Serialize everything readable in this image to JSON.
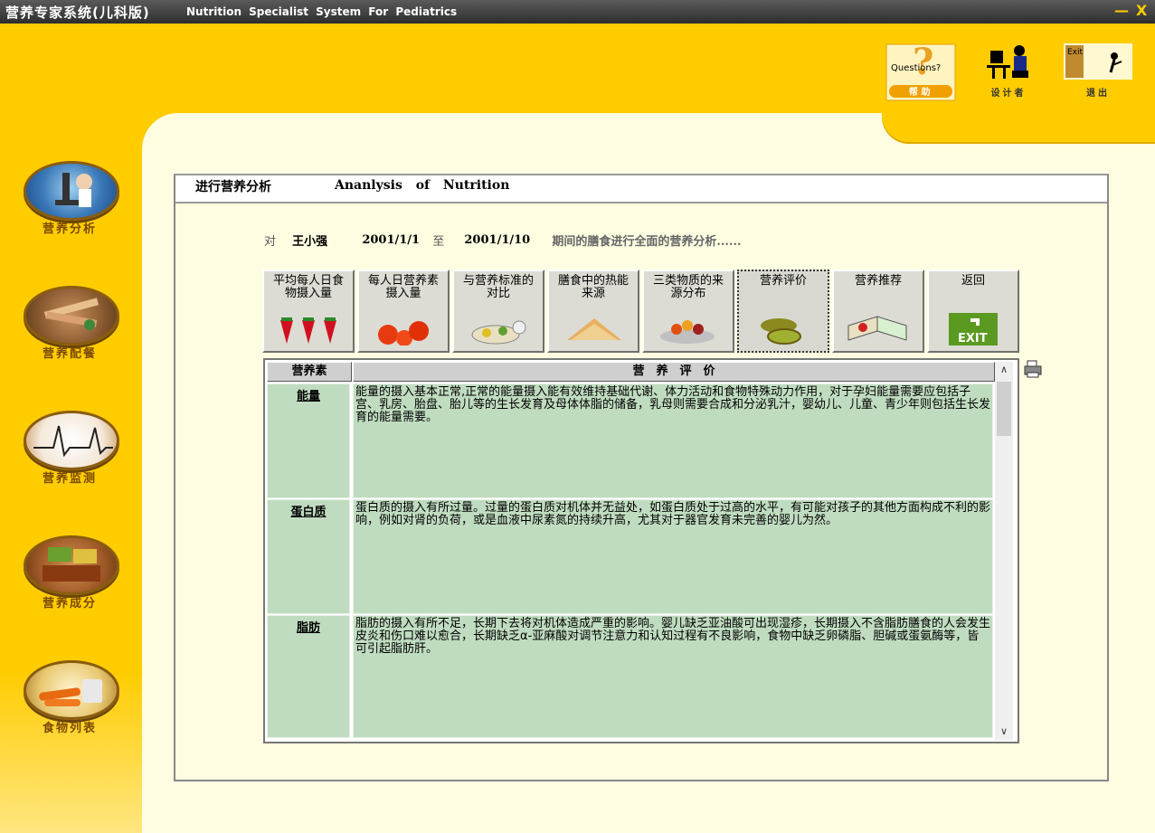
{
  "titlebar": {
    "app_name": "营养专家系统(儿科版)",
    "subtitle": "Nutrition Specialist System For Pediatrics",
    "minimize": "—",
    "close": "X"
  },
  "sidebar": {
    "items": [
      {
        "label": "营养分析",
        "icon": "microscope-icon"
      },
      {
        "label": "营养配餐",
        "icon": "meal-plate-icon"
      },
      {
        "label": "营养监测",
        "icon": "heartbeat-icon"
      },
      {
        "label": "营养成分",
        "icon": "food-box-icon"
      },
      {
        "label": "食物列表",
        "icon": "carrots-icon"
      }
    ]
  },
  "toolbar": {
    "help_image_text": "Questions?",
    "help_label": "帮 助",
    "designer_label": "设计者",
    "exit_image_text": "Exit",
    "exit_label": "退出"
  },
  "panel": {
    "title_cn": "进行营养分析",
    "title_en": "Ananlysis of Nutrition",
    "prefix": "对",
    "person": "王小强",
    "date_from": "2001/1/1",
    "to_word": "至",
    "date_to": "2001/1/10",
    "suffix": "期间的膳食进行全面的营养分析......"
  },
  "function_buttons": [
    {
      "label": "平均每人日食物摄入量",
      "icon": "strawberry-icon"
    },
    {
      "label": "每人日营养素摄入量",
      "icon": "tomato-icon"
    },
    {
      "label": "与营养标准的对比",
      "icon": "food-plate-icon"
    },
    {
      "label": "膳食中的热能来源",
      "icon": "bread-icon"
    },
    {
      "label": "三类物质的来源分布",
      "icon": "fruit-basket-icon"
    },
    {
      "label": "营养评价",
      "icon": "kiwi-icon",
      "selected": true
    },
    {
      "label": "营养推荐",
      "icon": "book-icon"
    },
    {
      "label": "返回",
      "icon": "exit-sign-icon",
      "image_text": "EXIT"
    }
  ],
  "evaluation_table": {
    "headers": [
      "营养素",
      "营　养　评　价"
    ],
    "rows": [
      {
        "nutrient": "能量",
        "evaluation": "能量的摄入基本正常,正常的能量摄入能有效维持基础代谢、体力活动和食物特殊动力作用，对于孕妇能量需要应包括子宫、乳房、胎盘、胎儿等的生长发育及母体体脂的储备，乳母则需要合成和分泌乳汁，婴幼儿、儿童、青少年则包括生长发育的能量需要。"
      },
      {
        "nutrient": "蛋白质",
        "evaluation": "蛋白质的摄入有所过量。过量的蛋白质对机体并无益处，如蛋白质处于过高的水平，有可能对孩子的其他方面构成不利的影响，例如对肾的负荷，或是血液中尿素氮的持续升高，尤其对于器官发育未完善的婴儿为然。"
      },
      {
        "nutrient": "脂肪",
        "evaluation": "脂肪的摄入有所不足，长期下去将对机体造成严重的影响。婴儿缺乏亚油酸可出现湿疹，长期摄入不含脂肪膳食的人会发生皮炎和伤口难以愈合，长期缺乏α-亚麻酸对调节注意力和认知过程有不良影响，食物中缺乏卵磷脂、胆碱或蛋氨酶等，皆可引起脂肪肝。"
      }
    ]
  },
  "colors": {
    "background": "#FFCC00",
    "content": "#FFFDE1",
    "grid_cell": "#C0DCC0",
    "button_face": "#DCDCD4"
  }
}
